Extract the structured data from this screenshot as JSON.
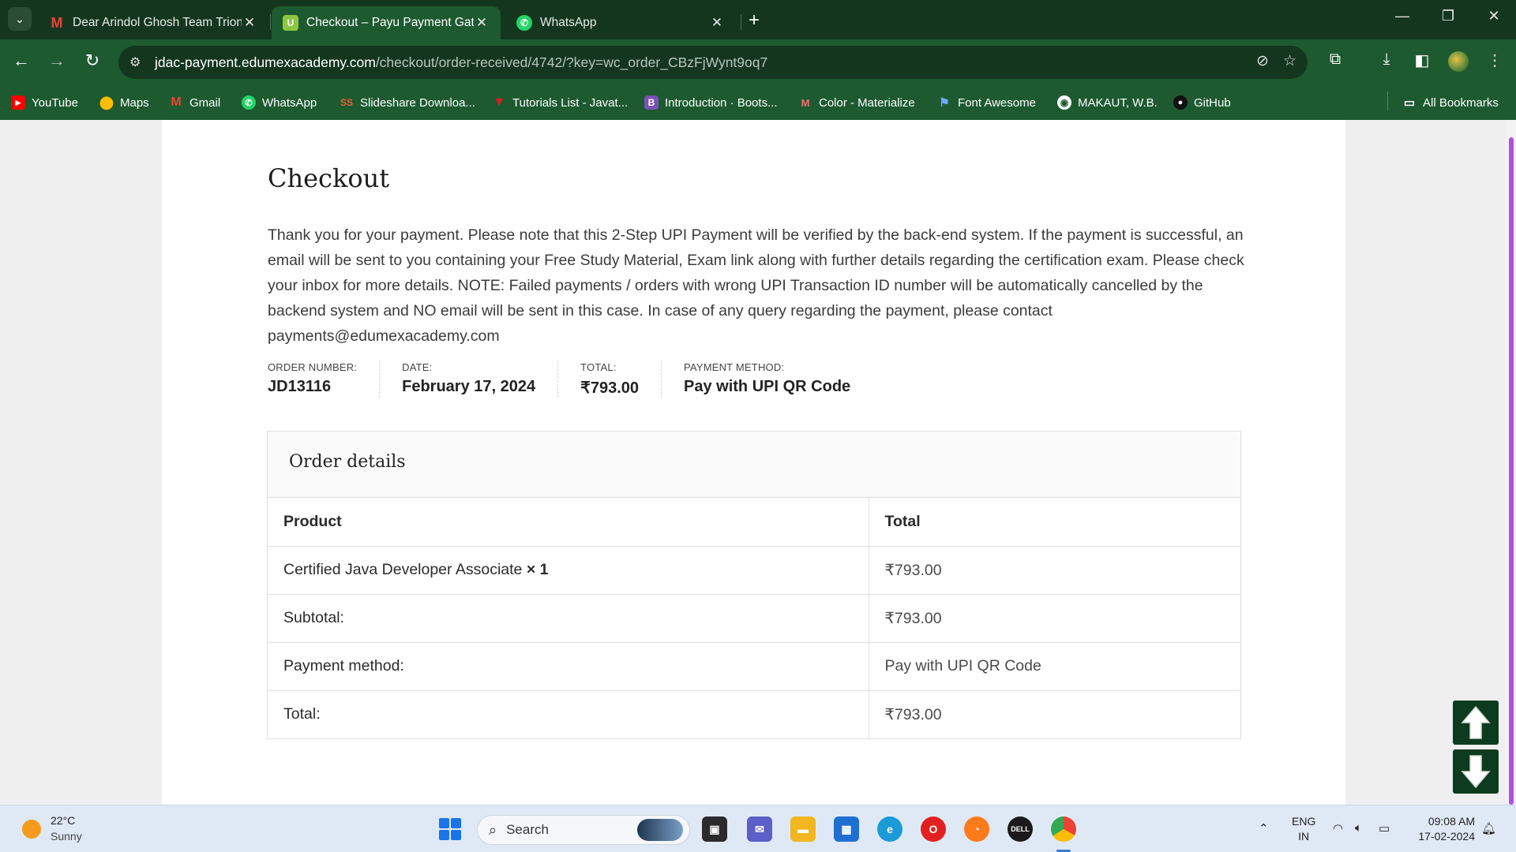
{
  "browser": {
    "tabs": [
      {
        "title": "Dear Arindol Ghosh Team Trion",
        "favicon": "gmail-icon",
        "active": false
      },
      {
        "title": "Checkout – Payu Payment Gate",
        "favicon": "upwork-like-icon",
        "active": true
      },
      {
        "title": "WhatsApp",
        "favicon": "whatsapp-icon",
        "active": false
      }
    ],
    "new_tab": "+",
    "url_host": "jdac-payment.edumexacademy.com",
    "url_path": "/checkout/order-received/4742/?key=wc_order_CBzFjWynt9oq7",
    "bookmarks": [
      {
        "label": "YouTube"
      },
      {
        "label": "Maps"
      },
      {
        "label": "Gmail"
      },
      {
        "label": "WhatsApp"
      },
      {
        "label": "Slideshare Downloa..."
      },
      {
        "label": "Tutorials List - Javat..."
      },
      {
        "label": "Introduction · Boots..."
      },
      {
        "label": "Color - Materialize"
      },
      {
        "label": "Font Awesome"
      },
      {
        "label": "MAKAUT, W.B."
      },
      {
        "label": "GitHub"
      }
    ],
    "all_bookmarks": "All Bookmarks",
    "colors": {
      "frame": "#14361f",
      "toolbar": "#1d5a30"
    }
  },
  "page": {
    "title": "Checkout",
    "notice": "Thank you for your payment. Please note that this 2-Step UPI Payment will be verified by the back-end system. If the payment is successful, an email will be sent to you containing your Free Study Material, Exam link along with further details regarding the certification exam. Please check your inbox for more details. NOTE: Failed payments / orders with wrong UPI Transaction ID number will be automatically cancelled by the backend system and NO email will be sent in this case. In case of any query regarding the payment, please contact payments@edumexacademy.com",
    "overview": {
      "order_number_label": "Order number:",
      "order_number": "JD13116",
      "date_label": "Date:",
      "date": "February 17, 2024",
      "total_label": "Total:",
      "total": "₹793.00",
      "payment_method_label": "Payment method:",
      "payment_method": "Pay with UPI QR Code"
    },
    "order_details": {
      "heading": "Order details",
      "col_product": "Product",
      "col_total": "Total",
      "item_name": "Certified Java Developer Associate",
      "item_qty": "× 1",
      "item_total": "₹793.00",
      "subtotal_label": "Subtotal:",
      "subtotal": "₹793.00",
      "payment_label": "Payment method:",
      "payment_value": "Pay with UPI QR Code",
      "total_label": "Total:",
      "total": "₹793.00"
    },
    "accent": "#0d3b1f"
  },
  "taskbar": {
    "weather_temp": "22°C",
    "weather_desc": "Sunny",
    "search_placeholder": "Search",
    "lang_top": "ENG",
    "lang_bottom": "IN",
    "time": "09:08 AM",
    "date": "17-02-2024"
  }
}
